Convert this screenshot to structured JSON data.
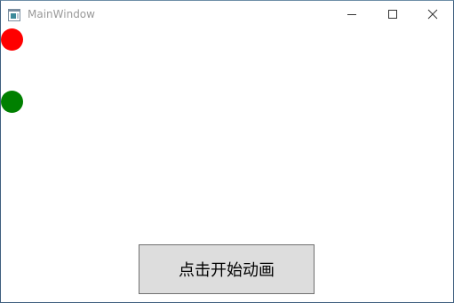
{
  "window": {
    "title": "MainWindow",
    "icon": "app-window-icon",
    "controls": {
      "minimize_icon": "minimize-icon",
      "maximize_icon": "maximize-icon",
      "close_icon": "close-icon"
    }
  },
  "content": {
    "balls": [
      {
        "name": "red-ball",
        "color": "#ff0000"
      },
      {
        "name": "green-ball",
        "color": "#008000"
      }
    ],
    "start_button_label": "点击开始动画"
  },
  "colors": {
    "window_border": "#3f5f7f",
    "button_background": "#dddddd",
    "button_border": "#707070"
  }
}
